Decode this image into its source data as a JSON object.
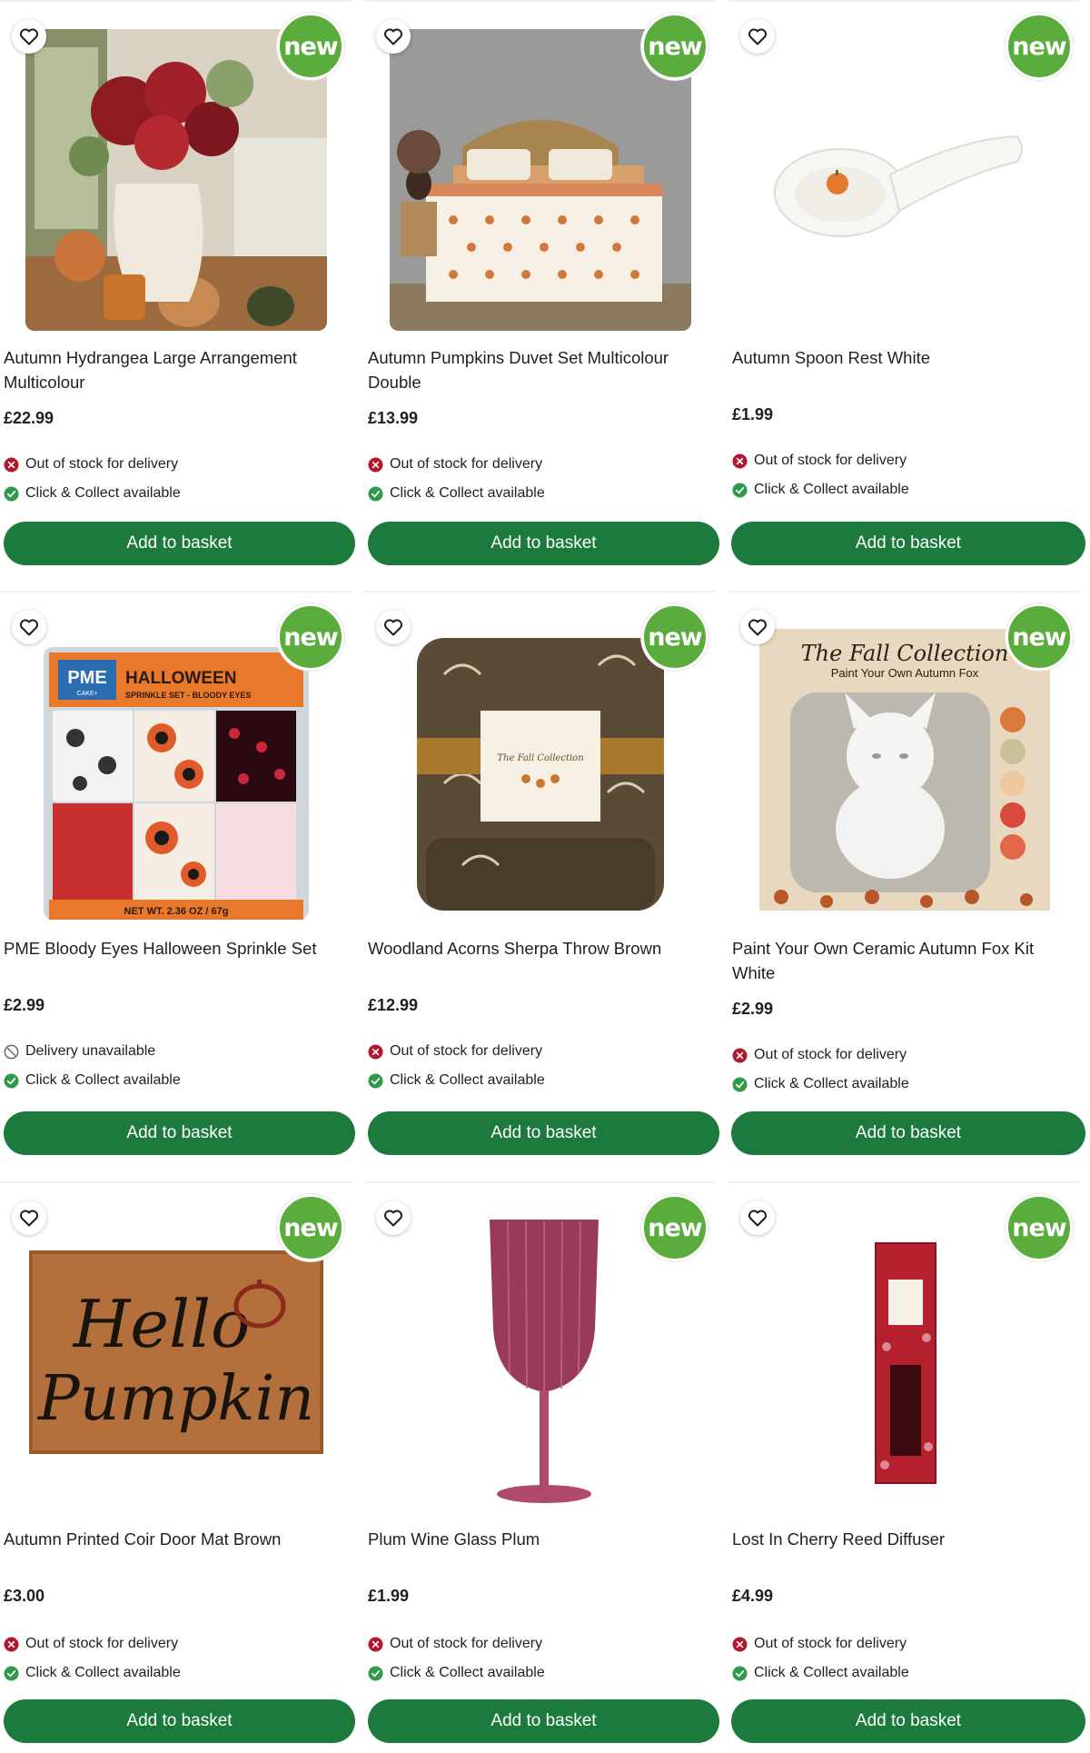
{
  "colors": {
    "brand_green": "#1d7a3d",
    "badge_green": "#5aac3d",
    "out_of_stock_red": "#b3182e",
    "available_green": "#2f9a4a"
  },
  "badge_label": "new",
  "button_label": "Add to basket",
  "products": [
    {
      "title": "Autumn Hydrangea Large Arrangement Multicolour",
      "price": "£22.99",
      "delivery": "Out of stock for delivery",
      "delivery_icon": "cross-circle-icon",
      "collect": "Click & Collect available",
      "image": "hydrangea-vase"
    },
    {
      "title": "Autumn Pumpkins Duvet Set Multicolour Double",
      "price": "£13.99",
      "delivery": "Out of stock for delivery",
      "delivery_icon": "cross-circle-icon",
      "collect": "Click & Collect available",
      "image": "duvet-set"
    },
    {
      "title": "Autumn Spoon Rest White",
      "price": "£1.99",
      "delivery": "Out of stock for delivery",
      "delivery_icon": "cross-circle-icon",
      "collect": "Click & Collect available",
      "image": "spoon-rest"
    },
    {
      "title": "PME Bloody Eyes Halloween Sprinkle Set",
      "price": "£2.99",
      "delivery": "Delivery unavailable",
      "delivery_icon": "unavailable-icon",
      "collect": "Click & Collect available",
      "image": "sprinkle-set"
    },
    {
      "title": "Woodland Acorns Sherpa Throw Brown",
      "price": "£12.99",
      "delivery": "Out of stock for delivery",
      "delivery_icon": "cross-circle-icon",
      "collect": "Click & Collect available",
      "image": "sherpa-throw"
    },
    {
      "title": "Paint Your Own Ceramic Autumn Fox Kit White",
      "price": "£2.99",
      "delivery": "Out of stock for delivery",
      "delivery_icon": "cross-circle-icon",
      "collect": "Click & Collect available",
      "image": "fox-kit"
    },
    {
      "title": "Autumn Printed Coir Door Mat Brown",
      "price": "£3.00",
      "delivery": "Out of stock for delivery",
      "delivery_icon": "cross-circle-icon",
      "collect": "Click & Collect available",
      "image": "door-mat"
    },
    {
      "title": "Plum Wine Glass Plum",
      "price": "£1.99",
      "delivery": "Out of stock for delivery",
      "delivery_icon": "cross-circle-icon",
      "collect": "Click & Collect available",
      "image": "wine-glass"
    },
    {
      "title": "Lost In Cherry Reed Diffuser",
      "price": "£4.99",
      "delivery": "Out of stock for delivery",
      "delivery_icon": "cross-circle-icon",
      "collect": "Click & Collect available",
      "image": "reed-diffuser"
    }
  ],
  "image_text": {
    "sprinkle_brand": "PME",
    "sprinkle_brand_sub": "CAKE+",
    "sprinkle_heading": "HALLOWEEN",
    "sprinkle_sub": "SPRINKLE SET - BLOODY EYES",
    "sprinkle_weight": "NET WT. 2.36 OZ / 67g",
    "throw_label": "The Fall Collection",
    "fox_heading": "The Fall Collection",
    "fox_sub": "Paint Your Own Autumn Fox",
    "mat_line1": "Hello",
    "mat_line2": "Pumpkin"
  }
}
